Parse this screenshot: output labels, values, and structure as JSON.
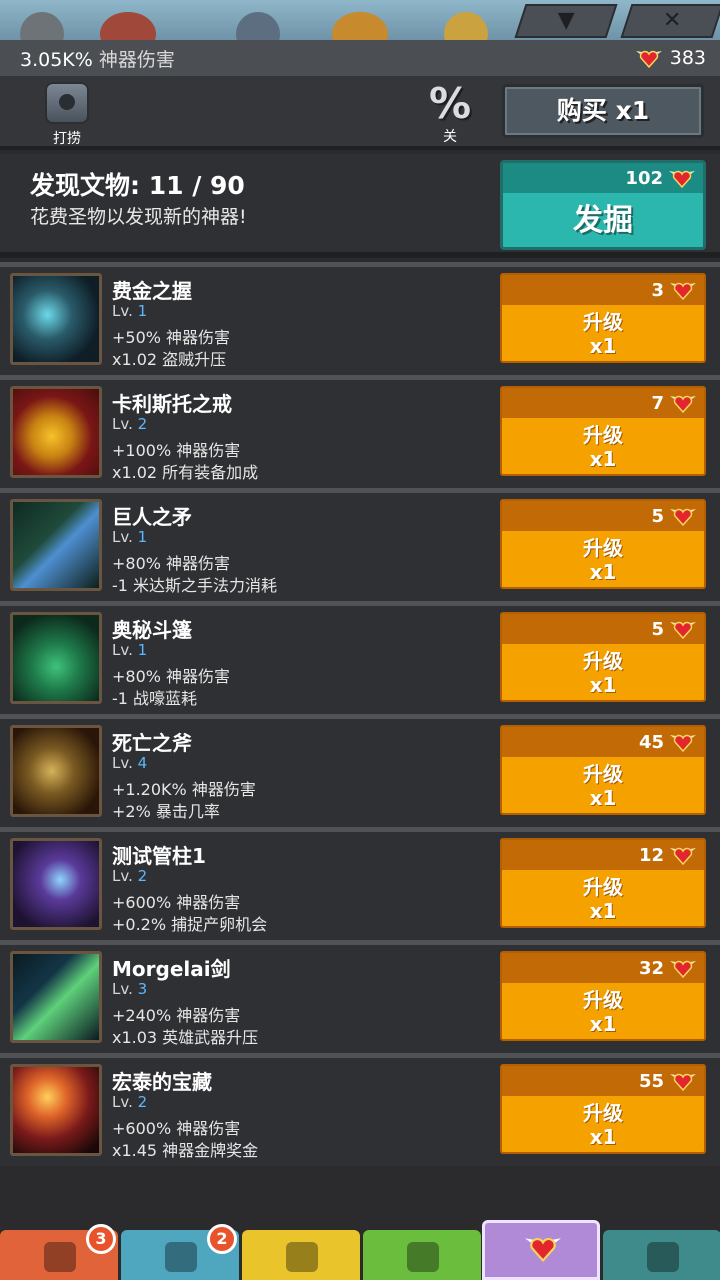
{
  "colors": {
    "upgrade_button": "#f5a200",
    "dig_button": "#2bb7ad",
    "level_number": "#5ab7ff",
    "badge": "#e9532c"
  },
  "top_icons": [
    "down-arrow-icon",
    "close-icon"
  ],
  "info": {
    "damage_value": "3.05K%",
    "damage_label": "神器伤害",
    "relic_count": "383",
    "relic_icon": "winged-heart-icon"
  },
  "toolbar": {
    "salvage_label": "打捞",
    "percent_symbol": "%",
    "percent_label": "关",
    "buy_label": "购买 x1"
  },
  "discover": {
    "title": "发现文物: 11 / 90",
    "description": "花费圣物以发现新的神器!",
    "cost": "102",
    "button_label": "发掘"
  },
  "artifacts": [
    {
      "name": "费金之握",
      "level": "1",
      "effect1": "+50% 神器伤害",
      "effect2": "x1.02 盗贼升压",
      "cost": "3",
      "icon": "gauntlet-icon"
    },
    {
      "name": "卡利斯托之戒",
      "level": "2",
      "effect1": "+100% 神器伤害",
      "effect2": "x1.02 所有装备加成",
      "cost": "7",
      "icon": "ring-icon"
    },
    {
      "name": "巨人之矛",
      "level": "1",
      "effect1": "+80% 神器伤害",
      "effect2": "-1 米达斯之手法力消耗",
      "cost": "5",
      "icon": "spear-icon"
    },
    {
      "name": "奥秘斗篷",
      "level": "1",
      "effect1": "+80% 神器伤害",
      "effect2": "-1 战嚎蓝耗",
      "cost": "5",
      "icon": "cloak-icon"
    },
    {
      "name": "死亡之斧",
      "level": "4",
      "effect1": "+1.20K% 神器伤害",
      "effect2": "+2% 暴击几率",
      "cost": "45",
      "icon": "axe-icon"
    },
    {
      "name": "测试管柱1",
      "level": "2",
      "effect1": "+600% 神器伤害",
      "effect2": "+0.2% 捕捉产卵机会",
      "cost": "12",
      "icon": "glove-icon"
    },
    {
      "name": "Morgelai剑",
      "level": "3",
      "effect1": "+240% 神器伤害",
      "effect2": "x1.03 英雄武器升压",
      "cost": "32",
      "icon": "sword-icon"
    },
    {
      "name": "宏泰的宝藏",
      "level": "2",
      "effect1": "+600% 神器伤害",
      "effect2": "x1.45 神器金牌奖金",
      "cost": "55",
      "icon": "coin-icon"
    }
  ],
  "labels": {
    "level_prefix": "Lv.",
    "upgrade_line1": "升级",
    "upgrade_line2": "x1"
  },
  "bottom_nav": [
    {
      "name": "sword",
      "badge": "3",
      "color": "#e0633a"
    },
    {
      "name": "hero",
      "badge": "2",
      "color": "#4fa7bf"
    },
    {
      "name": "equipment",
      "badge": "",
      "color": "#e9c42a"
    },
    {
      "name": "pet",
      "badge": "",
      "color": "#6bbd3e"
    },
    {
      "name": "artifacts",
      "badge": "",
      "color": "#b08ad6",
      "active": true
    },
    {
      "name": "shop",
      "badge": "",
      "color": "#3f8a8a"
    }
  ]
}
